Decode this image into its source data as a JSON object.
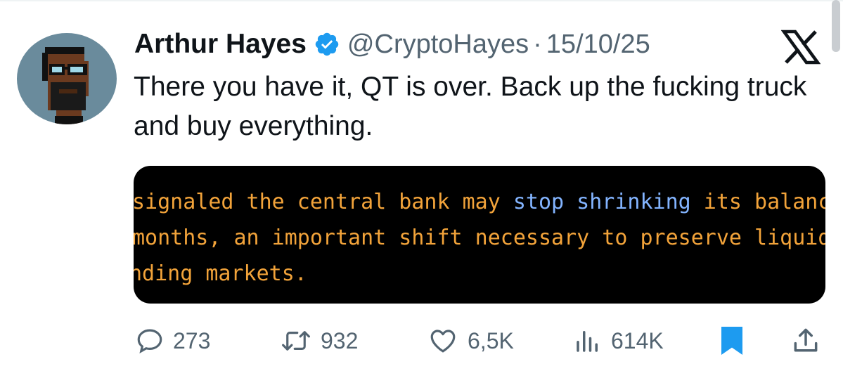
{
  "tweet": {
    "author_name": "Arthur Hayes",
    "handle": "@CryptoHayes",
    "separator": "·",
    "date": "15/10/25",
    "text": "There you have it, QT is over. Back up the fucking truck and buy everything."
  },
  "media": {
    "line1_pre": "signaled the central bank may ",
    "line1_highlight": "stop shrinking",
    "line1_post": " its balanc",
    "line2": "months, an important shift necessary to preserve liquid",
    "line3": "nding markets."
  },
  "actions": {
    "replies": "273",
    "reposts": "932",
    "likes": "6,5K",
    "views": "614K"
  },
  "colors": {
    "verified": "#1d9bf0",
    "bookmark_active": "#1d9bf0",
    "secondary_text": "#536471",
    "media_text_orange": "#f2a33a",
    "media_text_blue": "#83b4ff",
    "avatar_bg": "#6a8b9c"
  },
  "icons": {
    "verified": "verified-badge-icon",
    "platform": "x-logo-icon",
    "reply": "reply-icon",
    "repost": "repost-icon",
    "like": "heart-icon",
    "views": "views-icon",
    "bookmark": "bookmark-icon",
    "share": "share-icon"
  }
}
